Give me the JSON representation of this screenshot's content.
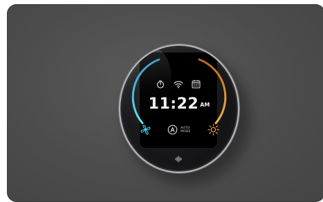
{
  "thermostat": {
    "time": "11:22",
    "ampm": "AM",
    "mode": {
      "line1": "AUTO",
      "line2": "MODE",
      "icon": "auto-mode-icon"
    },
    "status_icons": [
      "timer-icon",
      "wifi-icon",
      "calendar-icon"
    ],
    "left_control_icon": "fan-icon",
    "right_control_icon": "sun-icon",
    "bottom_icon": "voice-icon",
    "colors": {
      "cool_arc": "#3ec6e0",
      "heat_arc": "#f0a53a",
      "fan_icon": "#3ec6e0",
      "sun_icon": "#f0a53a",
      "text": "#f2f2f2"
    }
  }
}
